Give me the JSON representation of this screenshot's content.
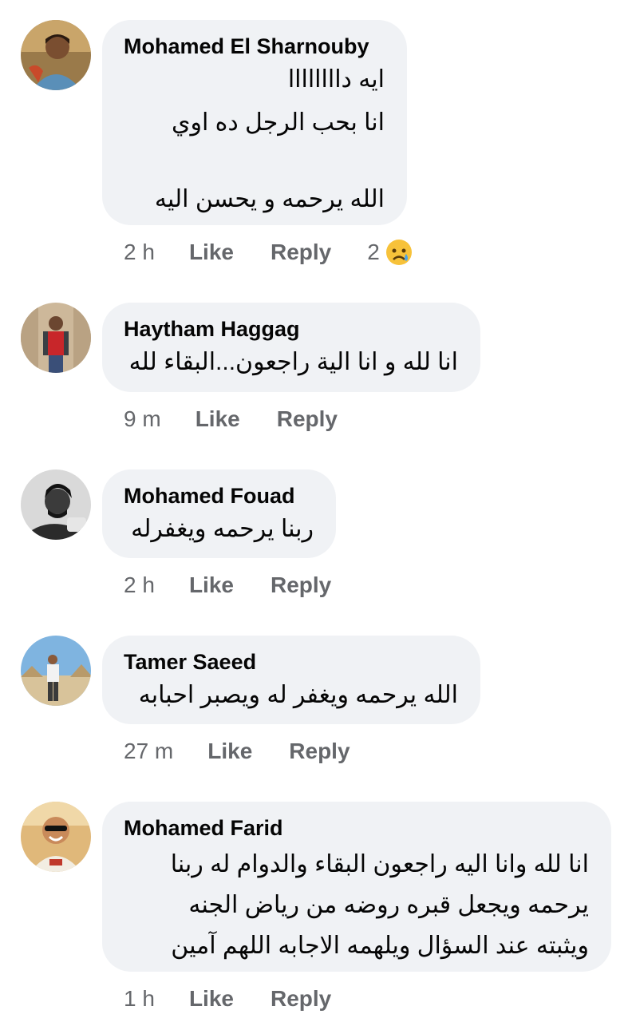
{
  "comments": [
    {
      "author": "Mohamed El Sharnouby",
      "lines": [
        "ايه داااااااا",
        "انا بحب الرجل ده اوي",
        "",
        "الله يرحمه و يحسن اليه"
      ],
      "time": "2 h",
      "like": "Like",
      "reply": "Reply",
      "reaction_count": "2",
      "reaction_icon": "crying-face-icon"
    },
    {
      "author": "Haytham Haggag",
      "lines": [
        "انا لله و انا الية راجعون...البقاء لله"
      ],
      "time": "9 m",
      "like": "Like",
      "reply": "Reply"
    },
    {
      "author": "Mohamed Fouad",
      "lines": [
        "ربنا يرحمه ويغفرله"
      ],
      "time": "2 h",
      "like": "Like",
      "reply": "Reply"
    },
    {
      "author": "Tamer Saeed",
      "lines": [
        "الله يرحمه ويغفر له ويصبر احبابه"
      ],
      "time": "27 m",
      "like": "Like",
      "reply": "Reply"
    },
    {
      "author": "Mohamed Farid",
      "lines": [
        "انا لله وانا اليه راجعون البقاء والدوام له ربنا",
        "يرحمه ويجعل قبره روضه من رياض الجنه",
        "ويثبته عند السؤال ويلهمه الاجابه اللهم آمين"
      ],
      "time": "1 h",
      "like": "Like",
      "reply": "Reply"
    }
  ],
  "colors": {
    "bubble": "#f0f2f5",
    "text": "#050505",
    "secondary": "#65676b"
  }
}
